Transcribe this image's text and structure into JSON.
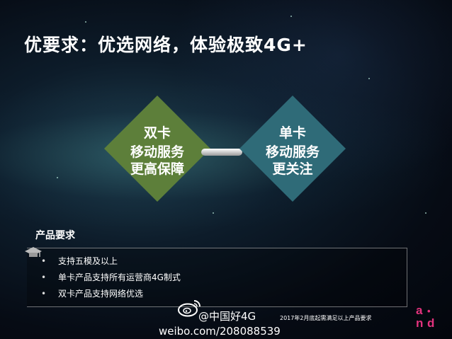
{
  "slide": {
    "title": "优要求：优选网络，体验极致4G+"
  },
  "diamonds": [
    {
      "line1": "双卡",
      "line2": "移动服务",
      "line3": "更高保障",
      "color": "#5d7f3a"
    },
    {
      "line1": "单卡",
      "line2": "移动服务",
      "line3": "更关注",
      "color": "#2f6b78"
    }
  ],
  "requirements": {
    "heading": "产品要求",
    "items": [
      {
        "bullet": "•",
        "text": "支持五模及以上"
      },
      {
        "bullet": "•",
        "text": "单卡产品支持所有运营商4G制式"
      },
      {
        "bullet": "•",
        "text": "双卡产品支持网络优选"
      }
    ]
  },
  "footer": {
    "note": "2017年2月底起需满足以上产品要求",
    "weibo_handle": "@中国好4G",
    "weibo_url": "weibo.com/208088539",
    "logo_text": "and"
  },
  "icons": [
    "weibo-icon",
    "graduation-cap-icon",
    "and-logo-icon"
  ]
}
